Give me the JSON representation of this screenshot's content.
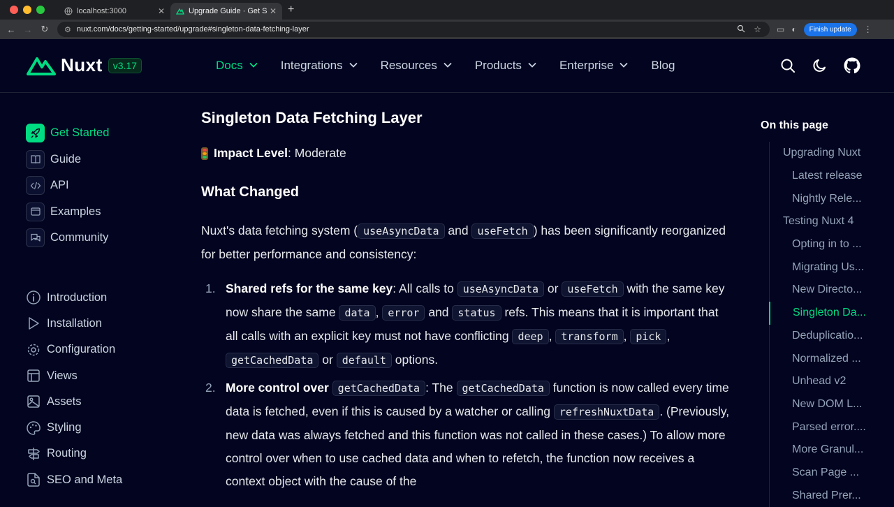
{
  "browser": {
    "tabs": [
      {
        "title": "localhost:3000",
        "active": false
      },
      {
        "title": "Upgrade Guide · Get Started",
        "active": true
      }
    ],
    "url": "nuxt.com/docs/getting-started/upgrade#singleton-data-fetching-layer",
    "finish_update": "Finish update"
  },
  "header": {
    "logo": "Nuxt",
    "version": "v3.17",
    "nav": [
      {
        "label": "Docs",
        "active": true,
        "chevron": true
      },
      {
        "label": "Integrations",
        "active": false,
        "chevron": true
      },
      {
        "label": "Resources",
        "active": false,
        "chevron": true
      },
      {
        "label": "Products",
        "active": false,
        "chevron": true
      },
      {
        "label": "Enterprise",
        "active": false,
        "chevron": true
      },
      {
        "label": "Blog",
        "active": false,
        "chevron": false
      }
    ]
  },
  "sidebar": {
    "sections": [
      {
        "label": "Get Started",
        "icon": "rocket-icon",
        "active": true
      },
      {
        "label": "Guide",
        "icon": "book-icon",
        "active": false
      },
      {
        "label": "API",
        "icon": "code-icon",
        "active": false
      },
      {
        "label": "Examples",
        "icon": "app-window-icon",
        "active": false
      },
      {
        "label": "Community",
        "icon": "chat-icon",
        "active": false
      }
    ],
    "pages": [
      {
        "label": "Introduction",
        "icon": "info-icon"
      },
      {
        "label": "Installation",
        "icon": "play-icon"
      },
      {
        "label": "Configuration",
        "icon": "gear-icon"
      },
      {
        "label": "Views",
        "icon": "layout-icon"
      },
      {
        "label": "Assets",
        "icon": "image-icon"
      },
      {
        "label": "Styling",
        "icon": "palette-icon"
      },
      {
        "label": "Routing",
        "icon": "signpost-icon"
      },
      {
        "label": "SEO and Meta",
        "icon": "file-search-icon"
      }
    ]
  },
  "content": {
    "heading": "Singleton Data Fetching Layer",
    "impact_label": "Impact Level",
    "impact_value": ": Moderate",
    "subheading": "What Changed",
    "intro": {
      "t1": "Nuxt's data fetching system (",
      "c1": "useAsyncData",
      "t2": " and ",
      "c2": "useFetch",
      "t3": ") has been significantly reorganized for better performance and consistency:"
    },
    "item1": {
      "num": "1.",
      "bold": "Shared refs for the same key",
      "t1": ": All calls to ",
      "c1": "useAsyncData",
      "t2": " or ",
      "c2": "useFetch",
      "t3": " with the same key now share the same ",
      "c3": "data",
      "t4": ", ",
      "c4": "error",
      "t5": " and ",
      "c5": "status",
      "t6": " refs. This means that it is important that all calls with an explicit key must not have conflicting ",
      "c6": "deep",
      "t7": ", ",
      "c7": "transform",
      "t8": ", ",
      "c8": "pick",
      "t9": ", ",
      "c9": "getCachedData",
      "t10": " or ",
      "c10": "default",
      "t11": " options."
    },
    "item2": {
      "num": "2.",
      "bold": "More control over ",
      "c1": "getCachedData",
      "t1": ": The ",
      "c2": "getCachedData",
      "t2": " function is now called every time data is fetched, even if this is caused by a watcher or calling ",
      "c3": "refreshNuxtData",
      "t3": ". (Previously, new data was always fetched and this function was not called in these cases.) To allow more control over when to use cached data and when to refetch, the function now receives a context object with the cause of the"
    }
  },
  "toc": {
    "title": "On this page",
    "items": [
      {
        "label": "Upgrading Nuxt",
        "level": 1,
        "active": false
      },
      {
        "label": "Latest release",
        "level": 2,
        "active": false
      },
      {
        "label": "Nightly Rele...",
        "level": 2,
        "active": false
      },
      {
        "label": "Testing Nuxt 4",
        "level": 1,
        "active": false
      },
      {
        "label": "Opting in to ...",
        "level": 2,
        "active": false
      },
      {
        "label": "Migrating Us...",
        "level": 2,
        "active": false
      },
      {
        "label": "New Directo...",
        "level": 2,
        "active": false
      },
      {
        "label": "Singleton Da...",
        "level": 2,
        "active": true
      },
      {
        "label": "Deduplicatio...",
        "level": 2,
        "active": false
      },
      {
        "label": "Normalized ...",
        "level": 2,
        "active": false
      },
      {
        "label": "Unhead v2",
        "level": 2,
        "active": false
      },
      {
        "label": "New DOM L...",
        "level": 2,
        "active": false
      },
      {
        "label": "Parsed error....",
        "level": 2,
        "active": false
      },
      {
        "label": "More Granul...",
        "level": 2,
        "active": false
      },
      {
        "label": "Scan Page ...",
        "level": 2,
        "active": false
      },
      {
        "label": "Shared Prer...",
        "level": 2,
        "active": false
      }
    ]
  },
  "colors": {
    "accent": "#00dc82",
    "background": "#020420"
  }
}
